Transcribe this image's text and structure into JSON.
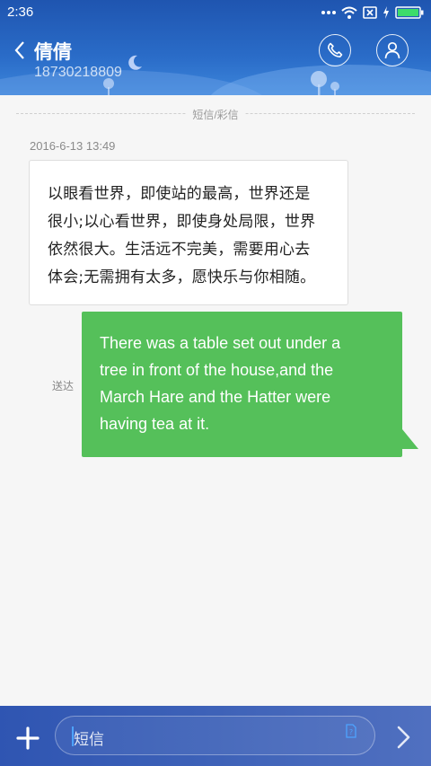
{
  "status_bar": {
    "time": "2:36",
    "icons": [
      "more-dots-icon",
      "wifi-icon",
      "no-sim-icon",
      "charging-icon",
      "battery-icon"
    ]
  },
  "header": {
    "contact_name": "倩倩",
    "contact_number": "18730218809",
    "icons": [
      "back-icon",
      "phone-icon",
      "person-icon"
    ]
  },
  "conversation": {
    "divider_label": "短信/彩信",
    "received": {
      "timestamp": "2016-6-13 13:49",
      "lines": [
        "以眼看世界，即使站的最高，世界还是",
        "很小;以心看世界，即使身处局限，世界",
        "依然很大。生活远不完美，需要用心去",
        "体会;无需拥有太多，愿快乐与你相随。"
      ]
    },
    "sent": {
      "status": "送达",
      "lines": [
        "There was a table set out under a",
        "tree in front of the house,and the",
        "March Hare and the Hatter were",
        "having tea at it."
      ]
    }
  },
  "composer": {
    "placeholder": "短信",
    "icons": [
      "add-icon",
      "mms-icon",
      "send-arrow-icon"
    ]
  },
  "colors": {
    "header_blue": "#2a6cc8",
    "sent_bubble": "#55c05a",
    "composer_bar": "#3e62b8"
  }
}
